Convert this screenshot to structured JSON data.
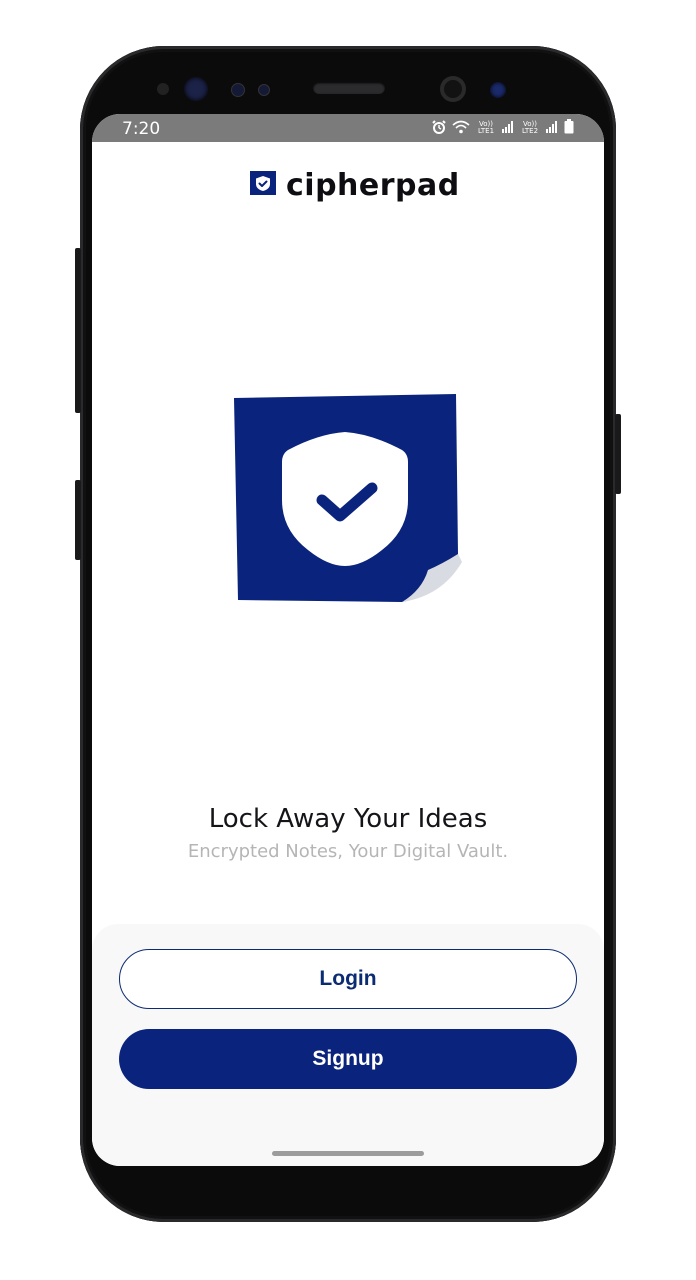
{
  "status_bar": {
    "time": "7:20",
    "sim1_label": "Vo)) LTE1",
    "sim2_label": "Vo)) LTE2",
    "icons": [
      "alarm-icon",
      "wifi-icon",
      "signal-icon",
      "battery-icon"
    ]
  },
  "brand": {
    "name": "cipherpad",
    "logo_icon": "shield-check-icon",
    "color": "#0a237c"
  },
  "hero": {
    "illustration": "shield-check-note-icon"
  },
  "intro": {
    "title": "Lock Away Your Ideas",
    "subtitle": "Encrypted Notes, Your Digital Vault."
  },
  "actions": {
    "login_label": "Login",
    "signup_label": "Signup",
    "primary_color": "#0a237c"
  }
}
